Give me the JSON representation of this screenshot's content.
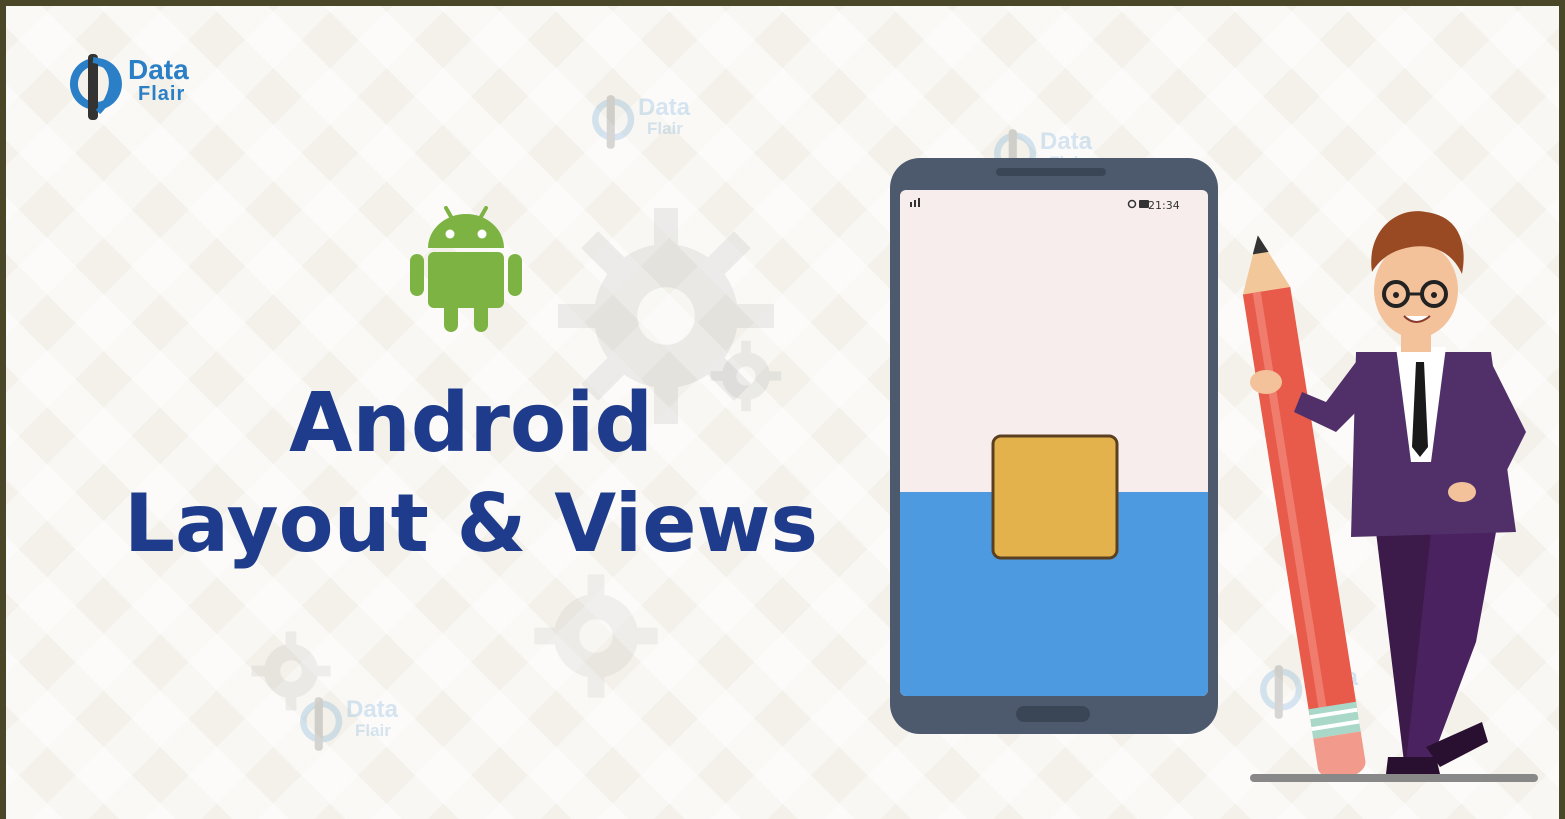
{
  "brand": {
    "line1": "Data",
    "line2": "Flair"
  },
  "title": {
    "line1": "Android",
    "line2": "Layout & Views"
  },
  "phone": {
    "status_time": "21:34"
  },
  "colors": {
    "title": "#1f3c8c",
    "android_green": "#7cb342",
    "brand_blue": "#2a7fc6",
    "phone_frame": "#4d5a6e",
    "screen_top": "#f8eded",
    "screen_bottom": "#4e9ae0",
    "square": "#e4b24c",
    "pencil": "#e85a4a"
  },
  "icons": [
    "data-flair-logo",
    "android-robot-icon",
    "smartphone-illustration",
    "pencil-illustration",
    "cartoon-person"
  ]
}
